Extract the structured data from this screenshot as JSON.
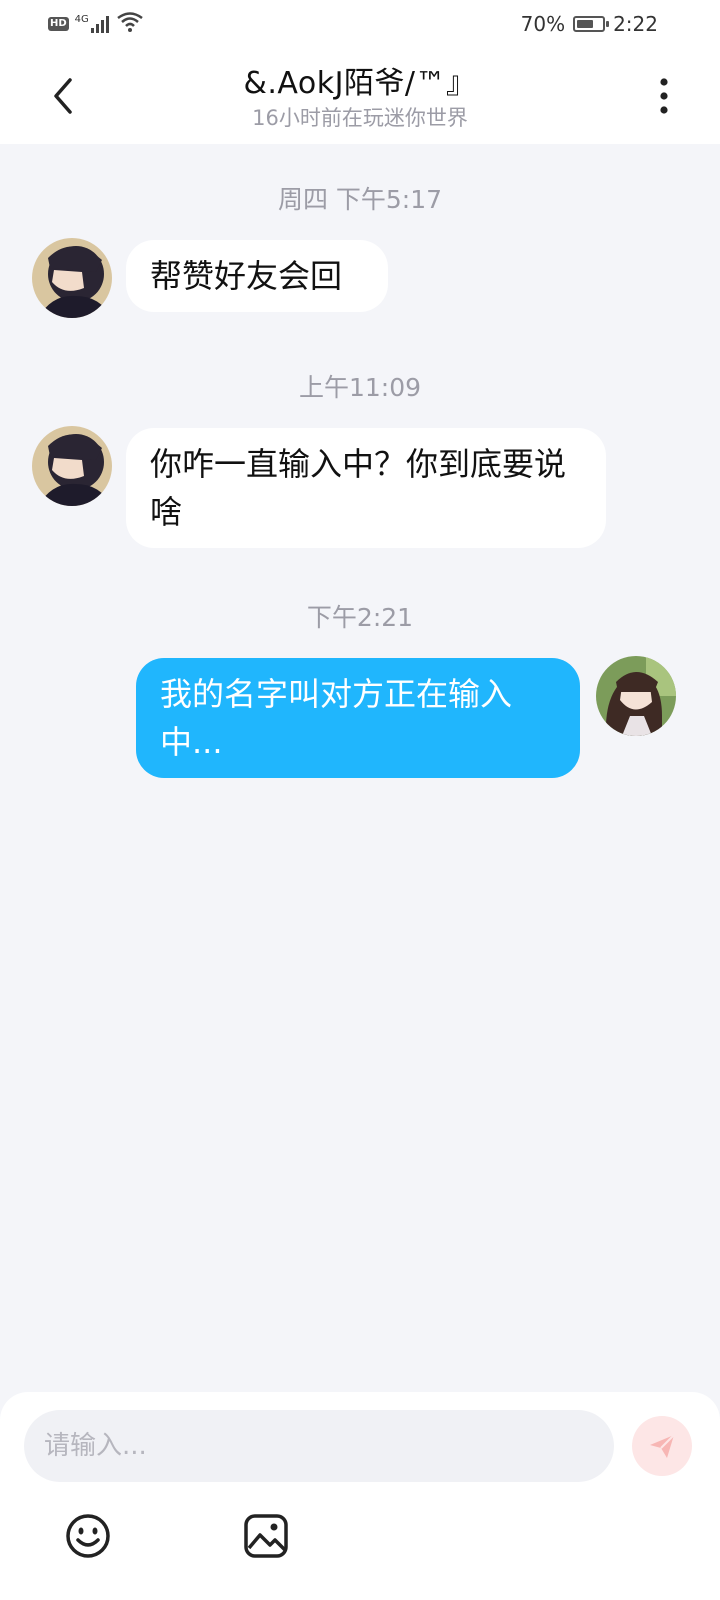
{
  "status_bar": {
    "left_badge": "HD",
    "network": "4G",
    "battery_text": "70%",
    "battery_level": 0.7,
    "time": "2:22"
  },
  "header": {
    "title": "&.AokJ陌爷/™』",
    "subtitle": "16小时前在玩迷你世界"
  },
  "messages": [
    {
      "timestamp": "周四 下午5:17",
      "direction": "incoming",
      "text": "帮赞好友会回"
    },
    {
      "timestamp": "上午11:09",
      "direction": "incoming",
      "text": "你咋一直输入中？你到底要说啥"
    },
    {
      "timestamp": "下午2:21",
      "direction": "outgoing",
      "text": "我的名字叫对方正在输入中..."
    }
  ],
  "input": {
    "placeholder": "请输入...",
    "value": ""
  },
  "icons": {
    "back": "chevron-left-icon",
    "more": "more-vertical-icon",
    "send": "send-icon",
    "emoji": "emoji-icon",
    "image": "image-icon"
  },
  "colors": {
    "background": "#f4f5f9",
    "outgoing_bubble": "#20b6fd",
    "incoming_bubble": "#ffffff",
    "send_button": "#fde6e6",
    "send_icon": "#f7b6b4"
  }
}
